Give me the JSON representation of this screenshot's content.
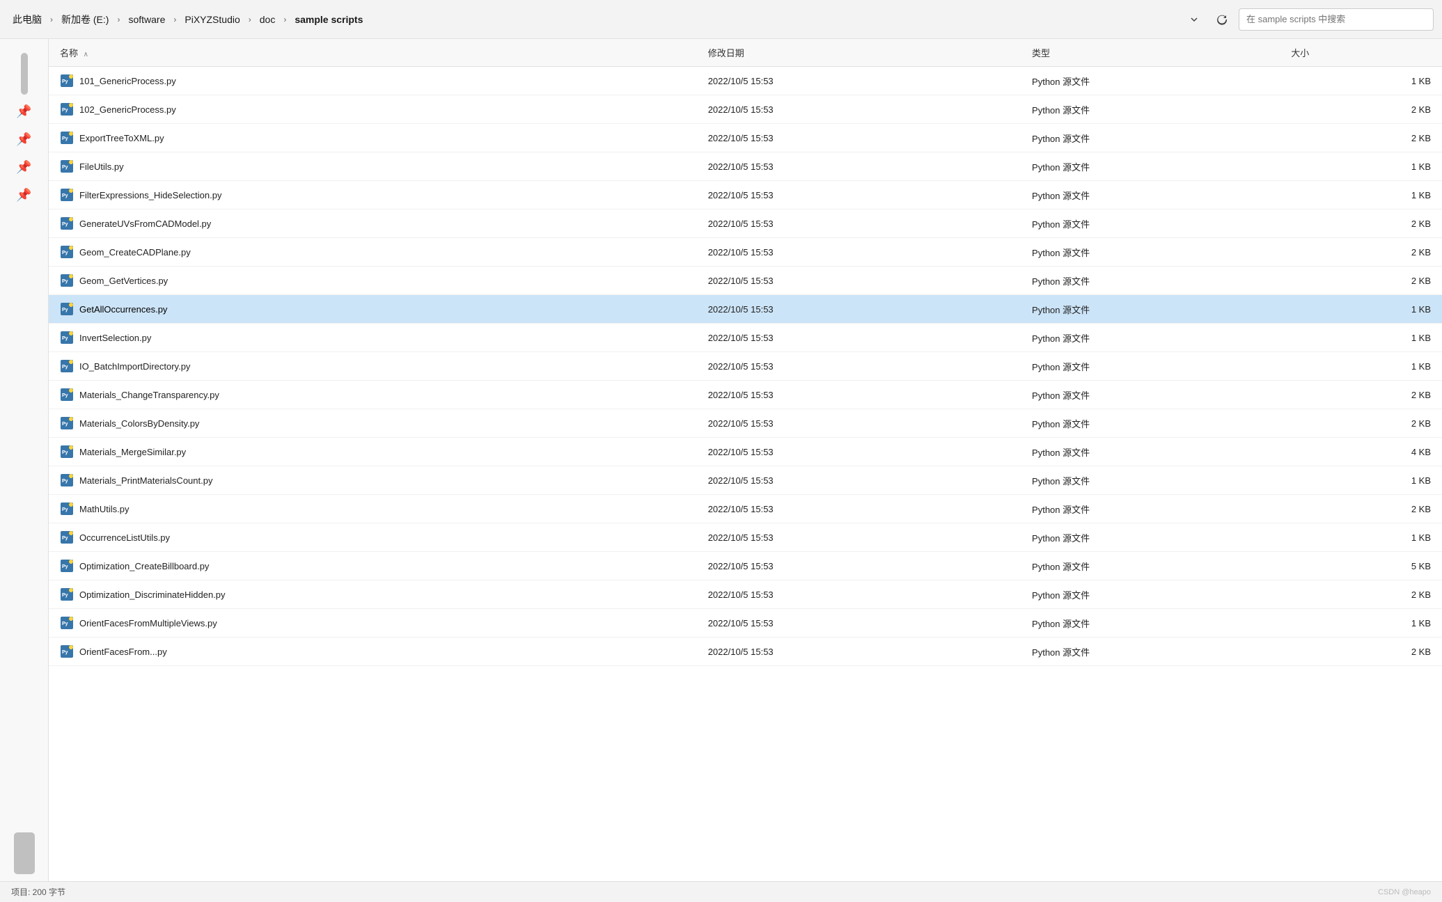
{
  "breadcrumb": {
    "items": [
      {
        "label": "此电脑",
        "separator": "›"
      },
      {
        "label": "新加卷 (E:)",
        "separator": "›"
      },
      {
        "label": "software",
        "separator": "›"
      },
      {
        "label": "PiXYZStudio",
        "separator": "›"
      },
      {
        "label": "doc",
        "separator": "›"
      },
      {
        "label": "sample scripts",
        "separator": ""
      }
    ],
    "search_placeholder": "在 sample scripts 中搜索"
  },
  "columns": {
    "name": "名称",
    "date": "修改日期",
    "type": "类型",
    "size": "大小",
    "sort_arrow": "∧"
  },
  "files": [
    {
      "name": "101_GenericProcess.py",
      "date": "2022/10/5 15:53",
      "type": "Python 源文件",
      "size": "1 KB"
    },
    {
      "name": "102_GenericProcess.py",
      "date": "2022/10/5 15:53",
      "type": "Python 源文件",
      "size": "2 KB"
    },
    {
      "name": "ExportTreeToXML.py",
      "date": "2022/10/5 15:53",
      "type": "Python 源文件",
      "size": "2 KB"
    },
    {
      "name": "FileUtils.py",
      "date": "2022/10/5 15:53",
      "type": "Python 源文件",
      "size": "1 KB"
    },
    {
      "name": "FilterExpressions_HideSelection.py",
      "date": "2022/10/5 15:53",
      "type": "Python 源文件",
      "size": "1 KB"
    },
    {
      "name": "GenerateUVsFromCADModel.py",
      "date": "2022/10/5 15:53",
      "type": "Python 源文件",
      "size": "2 KB"
    },
    {
      "name": "Geom_CreateCADPlane.py",
      "date": "2022/10/5 15:53",
      "type": "Python 源文件",
      "size": "2 KB"
    },
    {
      "name": "Geom_GetVertices.py",
      "date": "2022/10/5 15:53",
      "type": "Python 源文件",
      "size": "2 KB"
    },
    {
      "name": "GetAllOccurrences.py",
      "date": "2022/10/5 15:53",
      "type": "Python 源文件",
      "size": "1 KB",
      "selected": true
    },
    {
      "name": "InvertSelection.py",
      "date": "2022/10/5 15:53",
      "type": "Python 源文件",
      "size": "1 KB"
    },
    {
      "name": "IO_BatchImportDirectory.py",
      "date": "2022/10/5 15:53",
      "type": "Python 源文件",
      "size": "1 KB"
    },
    {
      "name": "Materials_ChangeTransparency.py",
      "date": "2022/10/5 15:53",
      "type": "Python 源文件",
      "size": "2 KB"
    },
    {
      "name": "Materials_ColorsByDensity.py",
      "date": "2022/10/5 15:53",
      "type": "Python 源文件",
      "size": "2 KB"
    },
    {
      "name": "Materials_MergeSimilar.py",
      "date": "2022/10/5 15:53",
      "type": "Python 源文件",
      "size": "4 KB"
    },
    {
      "name": "Materials_PrintMaterialsCount.py",
      "date": "2022/10/5 15:53",
      "type": "Python 源文件",
      "size": "1 KB"
    },
    {
      "name": "MathUtils.py",
      "date": "2022/10/5 15:53",
      "type": "Python 源文件",
      "size": "2 KB"
    },
    {
      "name": "OccurrenceListUtils.py",
      "date": "2022/10/5 15:53",
      "type": "Python 源文件",
      "size": "1 KB"
    },
    {
      "name": "Optimization_CreateBillboard.py",
      "date": "2022/10/5 15:53",
      "type": "Python 源文件",
      "size": "5 KB"
    },
    {
      "name": "Optimization_DiscriminateHidden.py",
      "date": "2022/10/5 15:53",
      "type": "Python 源文件",
      "size": "2 KB"
    },
    {
      "name": "OrientFacesFromMultipleViews.py",
      "date": "2022/10/5 15:53",
      "type": "Python 源文件",
      "size": "1 KB"
    },
    {
      "name": "OrientFacesFrom...py",
      "date": "2022/10/5 15:53",
      "type": "Python 源文件",
      "size": "2 KB"
    }
  ],
  "status_bar": {
    "count_label": "项目: 200 字节",
    "selected_label": ""
  },
  "watermark": "CSDN @heapo"
}
